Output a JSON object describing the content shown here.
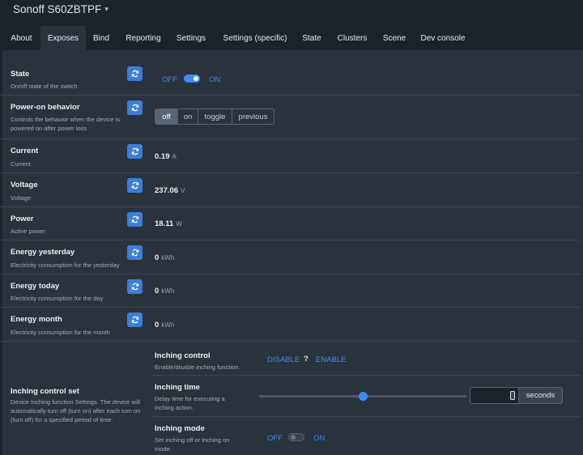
{
  "header": {
    "device_name": "Sonoff S60ZBTPF"
  },
  "tabs": [
    {
      "label": "About"
    },
    {
      "label": "Exposes"
    },
    {
      "label": "Bind"
    },
    {
      "label": "Reporting"
    },
    {
      "label": "Settings"
    },
    {
      "label": "Settings (specific)"
    },
    {
      "label": "State"
    },
    {
      "label": "Clusters"
    },
    {
      "label": "Scene"
    },
    {
      "label": "Dev console"
    }
  ],
  "active_tab": "Exposes",
  "exposes": {
    "state": {
      "title": "State",
      "desc": "On/off state of the switch",
      "off_label": "OFF",
      "on_label": "ON",
      "value": "ON"
    },
    "power_on": {
      "title": "Power-on behavior",
      "desc": "Controls the behavior when the device is powered on after power loss",
      "options": [
        "off",
        "on",
        "toggle",
        "previous"
      ],
      "selected": "off"
    },
    "current": {
      "title": "Current",
      "desc": "Current",
      "value": "0.19",
      "unit": "A"
    },
    "voltage": {
      "title": "Voltage",
      "desc": "Voltage",
      "value": "237.06",
      "unit": "V"
    },
    "power": {
      "title": "Power",
      "desc": "Active power",
      "value": "18.11",
      "unit": "W"
    },
    "energy_yesterday": {
      "title": "Energy yesterday",
      "desc": "Electricity consumption for the yesterday",
      "value": "0",
      "unit": "kWh"
    },
    "energy_today": {
      "title": "Energy today",
      "desc": "Electricity consumption for the day",
      "value": "0",
      "unit": "kWh"
    },
    "energy_month": {
      "title": "Energy month",
      "desc": "Electricity consumption for the month",
      "value": "0",
      "unit": "kWh"
    },
    "inching": {
      "title": "Inching control set",
      "desc": "Device Inching function Settings. The device will automatically turn off (turn on) after each turn on (turn off) for a specified period of time.",
      "control": {
        "title": "Inching control",
        "desc": "Enable/disable inching function.",
        "disable_label": "DISABLE",
        "unknown_label": "?",
        "enable_label": "ENABLE"
      },
      "time": {
        "title": "Inching time",
        "desc": "Delay time for executing a inching action.",
        "input_value": "",
        "unit_label": "seconds",
        "slider_fraction": 0.5
      },
      "mode": {
        "title": "Inching mode",
        "desc": "Set inching off or inching on mode.",
        "off_label": "OFF",
        "on_label": "ON",
        "value": "OFF"
      }
    }
  },
  "colors": {
    "accent": "#3b8cff",
    "refresh_button": "#3a7fdb",
    "panel": "#2a323c",
    "background": "#1d232a"
  }
}
